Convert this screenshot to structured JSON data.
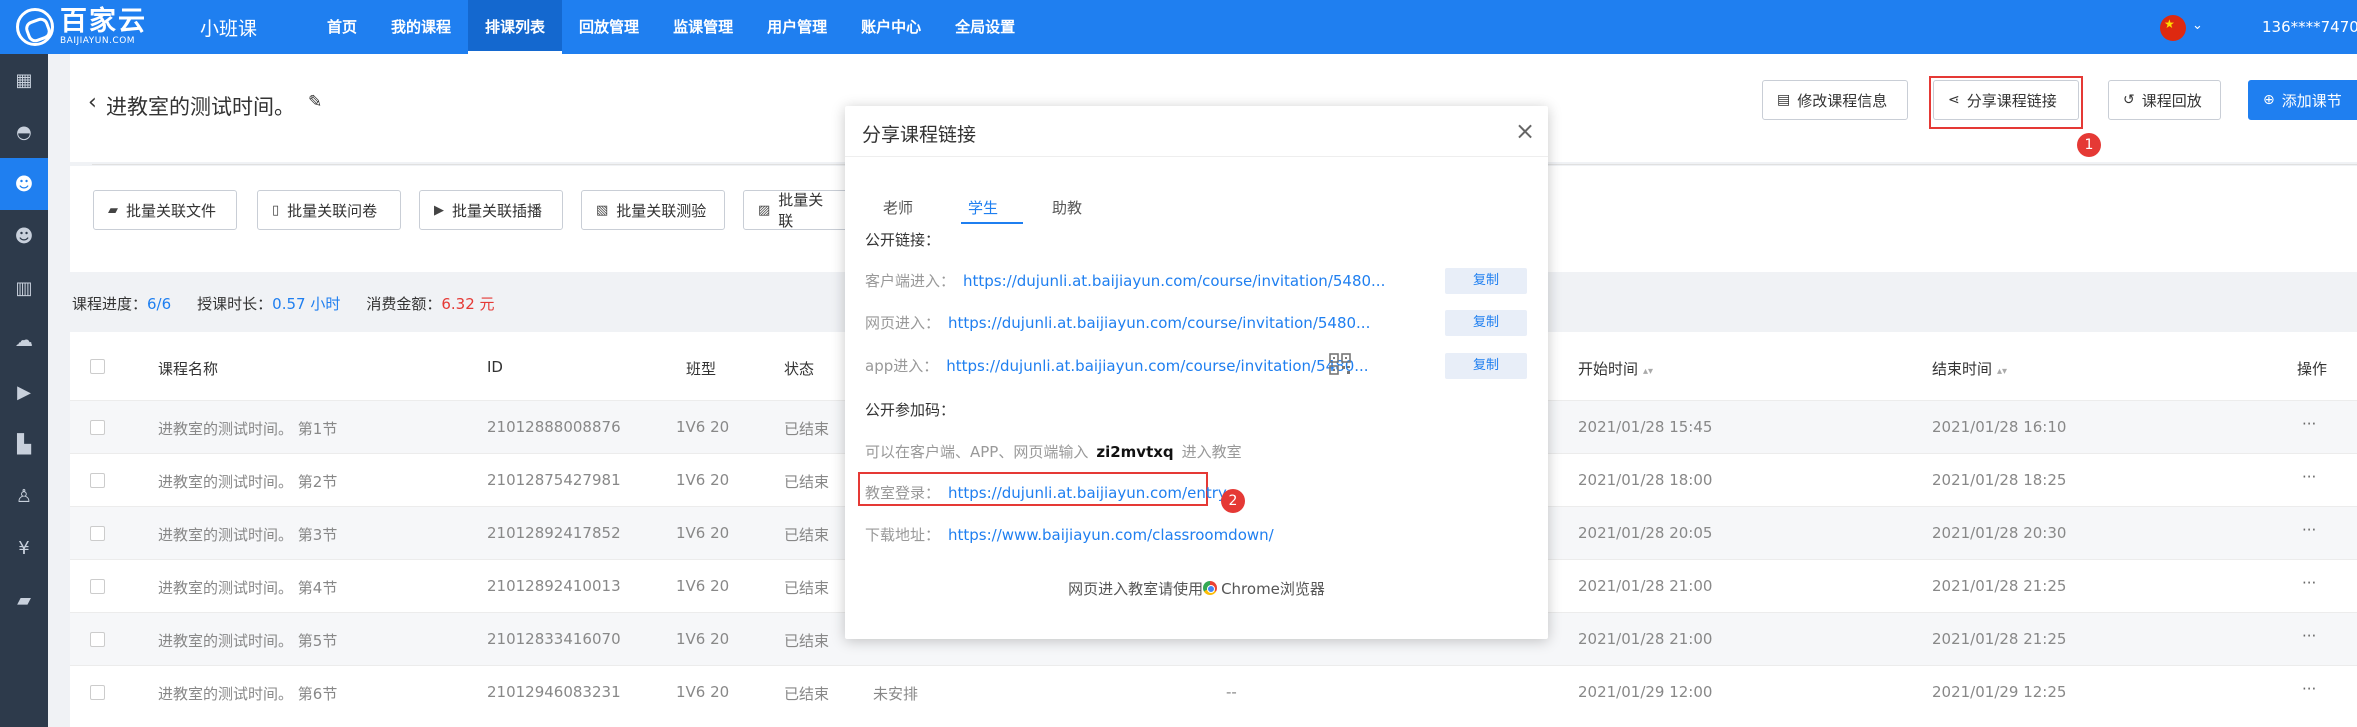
{
  "brand": {
    "logo_cn": "百家云",
    "logo_en": "BAIJIAYUN.COM",
    "product": "小班课"
  },
  "nav": {
    "items": [
      {
        "label": "首页"
      },
      {
        "label": "我的课程"
      },
      {
        "label": "排课列表",
        "active": true
      },
      {
        "label": "回放管理"
      },
      {
        "label": "监课管理"
      },
      {
        "label": "用户管理"
      },
      {
        "label": "账户中心"
      },
      {
        "label": "全局设置"
      }
    ],
    "user": "136****7470"
  },
  "sidebar": {
    "icons": [
      "grid-icon",
      "user-icon",
      "users-icon",
      "group-icon",
      "building-icon",
      "cloud-icon",
      "play-icon",
      "org-icon",
      "teacher-icon",
      "yen-icon",
      "folder-icon"
    ],
    "active_index": 2
  },
  "header": {
    "back": "‹",
    "title": "进教室的测试时间。",
    "edit_icon": "✎",
    "buttons": {
      "edit_info": "修改课程信息",
      "share_link": "分享课程链接",
      "replay": "课程回放",
      "add_lesson": "添加课节"
    },
    "badge1": "1"
  },
  "batch": {
    "buttons": [
      "批量关联文件",
      "批量关联问卷",
      "批量关联插播",
      "批量关联测验",
      "批量关联"
    ]
  },
  "stats": {
    "progress_label": "课程进度：",
    "progress_value": "6/6",
    "duration_label": "授课时长：",
    "duration_value": "0.57 小时",
    "cost_label": "消费金额：",
    "cost_value": "6.32 元"
  },
  "table": {
    "headers": {
      "name": "课程名称",
      "id": "ID",
      "class_type": "班型",
      "status": "状态",
      "start": "开始时间",
      "end": "结束时间",
      "ops": "操作"
    },
    "rows": [
      {
        "name": "进教室的测试时间。 第1节",
        "id": "21012888008876",
        "type": "1V6 20",
        "status": "已结束",
        "extra": "",
        "dash": "",
        "start": "2021/01/28 15:45",
        "end": "2021/01/28 16:10",
        "ops": "···"
      },
      {
        "name": "进教室的测试时间。 第2节",
        "id": "21012875427981",
        "type": "1V6 20",
        "status": "已结束",
        "extra": "",
        "dash": "",
        "start": "2021/01/28 18:00",
        "end": "2021/01/28 18:25",
        "ops": "···"
      },
      {
        "name": "进教室的测试时间。 第3节",
        "id": "21012892417852",
        "type": "1V6 20",
        "status": "已结束",
        "extra": "",
        "dash": "",
        "start": "2021/01/28 20:05",
        "end": "2021/01/28 20:30",
        "ops": "···"
      },
      {
        "name": "进教室的测试时间。 第4节",
        "id": "21012892410013",
        "type": "1V6 20",
        "status": "已结束",
        "extra": "",
        "dash": "",
        "start": "2021/01/28 21:00",
        "end": "2021/01/28 21:25",
        "ops": "···"
      },
      {
        "name": "进教室的测试时间。 第5节",
        "id": "21012833416070",
        "type": "1V6 20",
        "status": "已结束",
        "extra": "",
        "dash": "",
        "start": "2021/01/28 21:00",
        "end": "2021/01/28 21:25",
        "ops": "···"
      },
      {
        "name": "进教室的测试时间。 第6节",
        "id": "21012946083231",
        "type": "1V6 20",
        "status": "已结束",
        "extra": "未安排",
        "dash": "--",
        "start": "2021/01/29 12:00",
        "end": "2021/01/29 12:25",
        "ops": "···"
      }
    ]
  },
  "modal": {
    "title": "分享课程链接",
    "close": "×",
    "tabs": [
      "老师",
      "学生",
      "助教"
    ],
    "active_tab": 1,
    "public_link_label": "公开链接：",
    "client_label": "客户端进入：",
    "client_url": "https://dujunli.at.baijiayun.com/course/invitation/5480...",
    "web_label": "网页进入：",
    "web_url": "https://dujunli.at.baijiayun.com/course/invitation/5480...",
    "app_label": "app进入：",
    "app_url": "https://dujunli.at.baijiayun.com/course/invitation/5480...",
    "copy": "复制",
    "code_label": "公开参加码：",
    "code_prefix": "可以在客户端、APP、网页端输入",
    "code": "zi2mvtxq",
    "code_suffix": "进入教室",
    "entry_label": "教室登录：",
    "entry_url": "https://dujunli.at.baijiayun.com/entry",
    "download_label": "下载地址：",
    "download_url": "https://www.baijiayun.com/classroomdown/",
    "footer": "网页进入教室请使用",
    "footer_browser": "Chrome浏览器",
    "badge2": "2"
  }
}
